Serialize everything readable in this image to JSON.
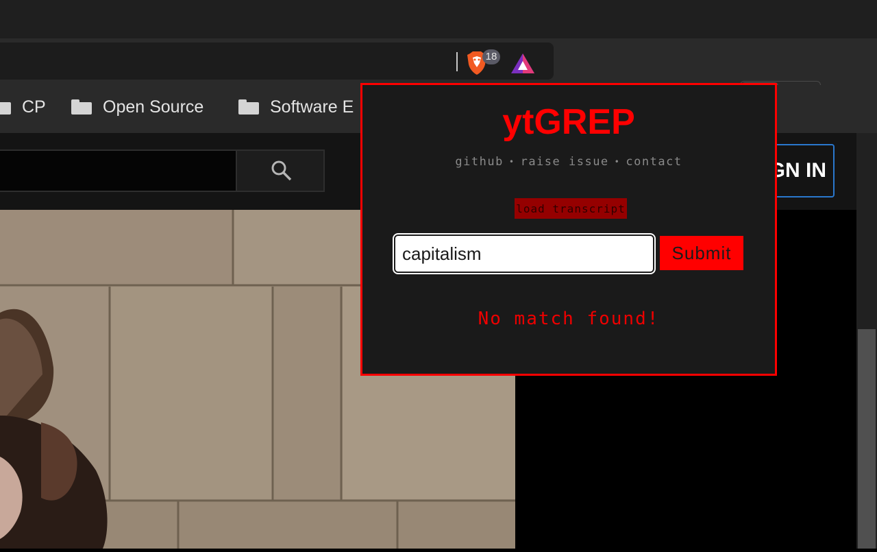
{
  "toolbar": {
    "brave_shields_count": "18"
  },
  "bookmarks": [
    {
      "label": "CP"
    },
    {
      "label": "Open Source"
    },
    {
      "label": "Software E"
    }
  ],
  "youtube": {
    "signin_label": "SIGN IN"
  },
  "popup": {
    "title": "ytGREP",
    "links": [
      "github",
      "raise issue",
      "contact"
    ],
    "load_button_label": "load transcript",
    "search_value": "capitalism",
    "submit_label": "Submit",
    "result_message": "No match found!"
  },
  "colors": {
    "accent": "#ff0000",
    "popup_bg": "#1a1a1a",
    "signin_border": "#2a78ce"
  }
}
